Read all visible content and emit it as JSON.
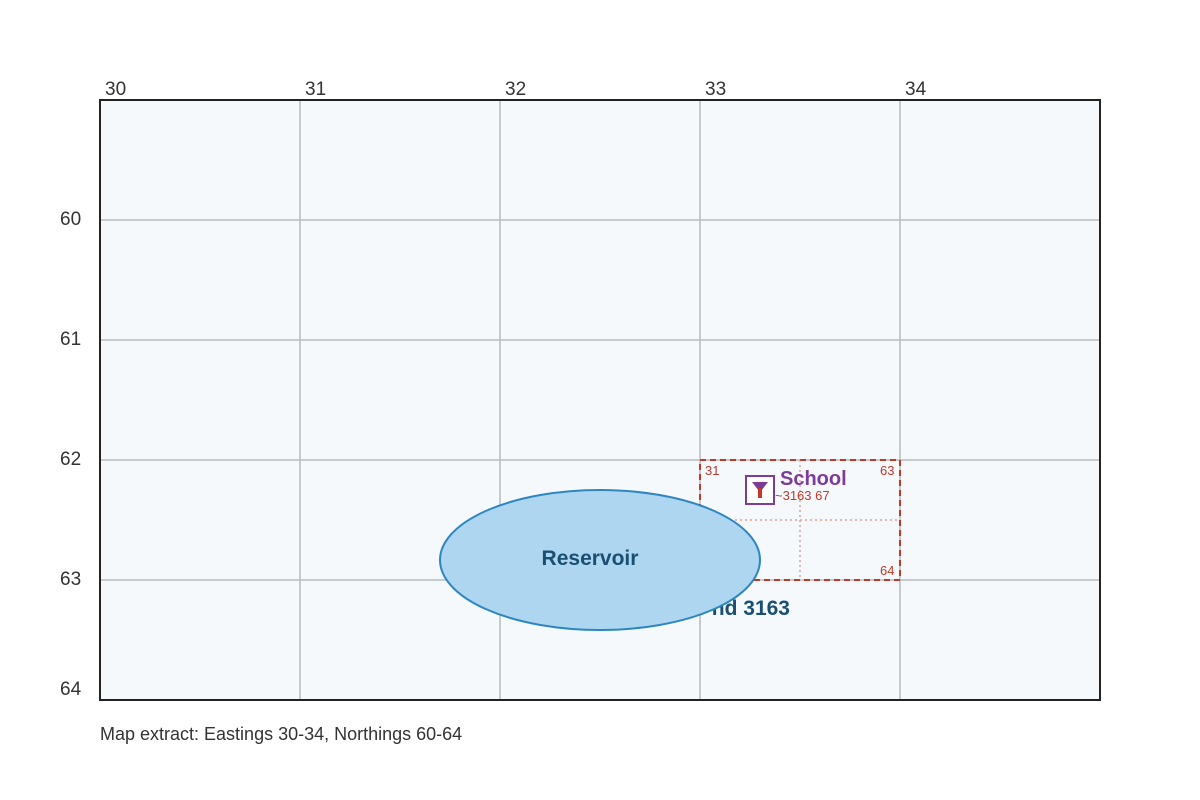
{
  "eastings": [
    "30",
    "31",
    "32",
    "33",
    "34"
  ],
  "northings": [
    "60",
    "61",
    "62",
    "63",
    "64"
  ],
  "zoom": {
    "corner_top_left": "31",
    "corner_top_right": "63",
    "corner_bottom_right": "64"
  },
  "school": {
    "label": "School",
    "grid_ref": "~3163 67",
    "icon": "school-icon"
  },
  "reservoir": {
    "label": "Reservoir"
  },
  "grid_ref_text": "nd 3163",
  "caption": "Map extract: Eastings 30-34, Northings 60-64",
  "colors": {
    "grid": "#b9bcbf",
    "frame_fill": "#f5f9fc",
    "zoom": "#c0392b",
    "school": "#7d3c98",
    "reservoir_fill": "#aed6f1",
    "reservoir_stroke": "#2e86c1",
    "text_dark_blue": "#1b4f72"
  }
}
